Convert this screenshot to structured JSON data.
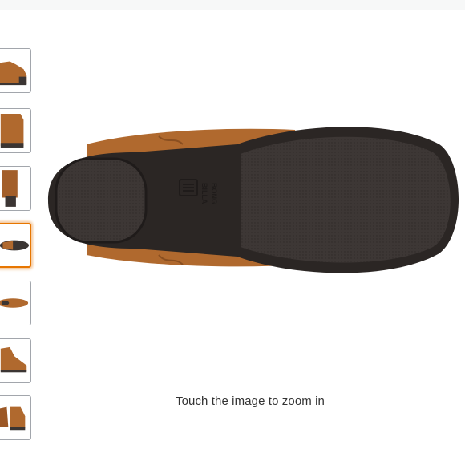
{
  "page": {
    "zoom_hint": "Touch the image to zoom in"
  },
  "main_image": {
    "brand_mark": "BILLA BONG",
    "icon": "shoe-sole-image"
  },
  "thumbnails": [
    {
      "view": "side-view",
      "selected": false
    },
    {
      "view": "back-view",
      "selected": false
    },
    {
      "view": "heel-view",
      "selected": false
    },
    {
      "view": "sole-view",
      "selected": true
    },
    {
      "view": "top-view",
      "selected": false
    },
    {
      "view": "angle-view",
      "selected": false
    },
    {
      "view": "pair-view",
      "selected": false
    }
  ],
  "colors": {
    "accent": "#e77600",
    "suede": "#b0692e",
    "sole": "#3b3533"
  }
}
